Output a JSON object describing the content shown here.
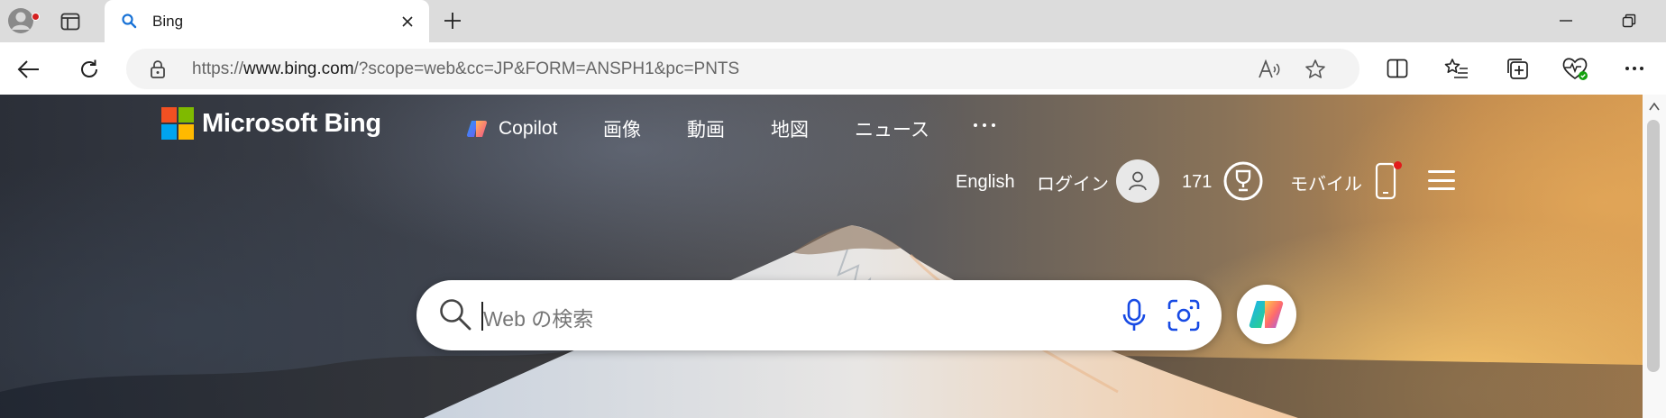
{
  "browser": {
    "tab": {
      "title": "Bing"
    },
    "address": {
      "url_prefix": "https://",
      "url_host": "www.bing.com",
      "url_path": "/?scope=web&cc=JP&FORM=ANSPH1&pc=PNTS"
    }
  },
  "bing": {
    "logo_text": "Microsoft Bing",
    "nav": {
      "copilot": "Copilot",
      "images": "画像",
      "videos": "動画",
      "maps": "地図",
      "news": "ニュース"
    },
    "header": {
      "language": "English",
      "login": "ログイン",
      "points": "171",
      "mobile": "モバイル"
    },
    "search": {
      "placeholder": "Web の検索"
    },
    "logo_colors": [
      "#f25022",
      "#7fba00",
      "#00a4ef",
      "#ffb900"
    ]
  }
}
